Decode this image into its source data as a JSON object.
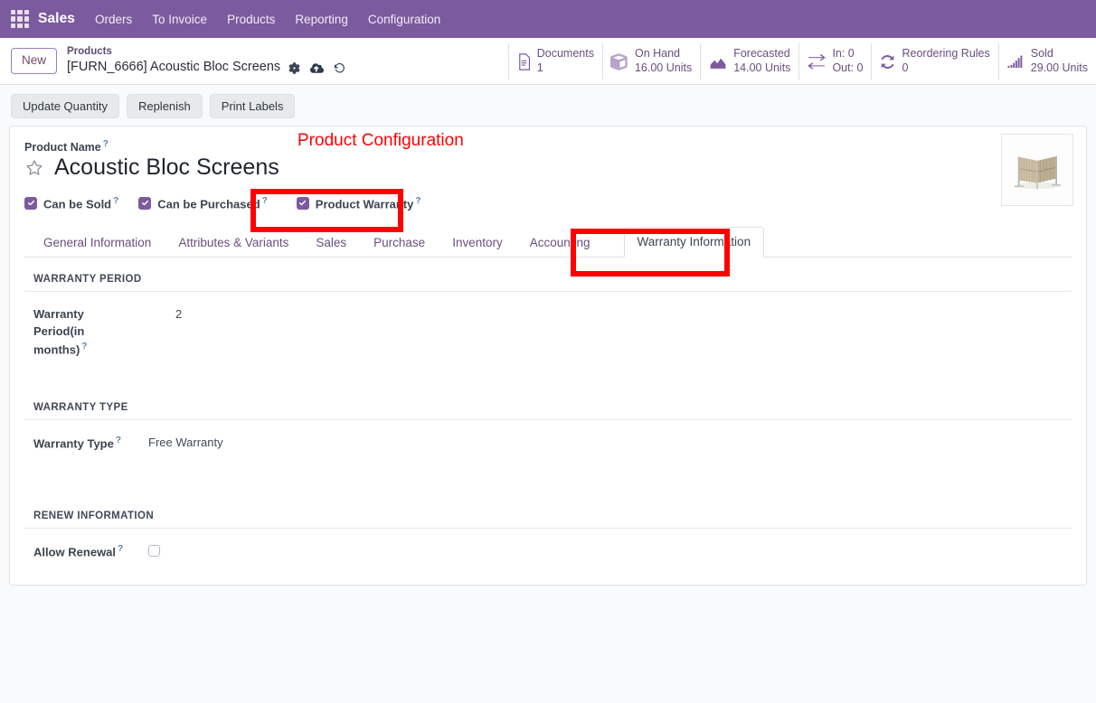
{
  "navbar": {
    "apps_icon": "apps-grid-icon",
    "brand": "Sales",
    "menu": [
      {
        "label": "Orders"
      },
      {
        "label": "To Invoice"
      },
      {
        "label": "Products"
      },
      {
        "label": "Reporting"
      },
      {
        "label": "Configuration"
      }
    ]
  },
  "control_panel": {
    "new_button": "New",
    "breadcrumb_parent": "Products",
    "breadcrumb_current": "[FURN_6666] Acoustic Bloc Screens",
    "icons": [
      {
        "name": "gear-icon",
        "glyph": "⚙"
      },
      {
        "name": "cloud-upload-icon",
        "glyph": "☁"
      },
      {
        "name": "discard-undo-icon",
        "glyph": "↺"
      }
    ],
    "stat_buttons": [
      {
        "name": "documents",
        "icon": "document-icon",
        "line1": "Documents",
        "line2": "1"
      },
      {
        "name": "on-hand",
        "icon": "boxes-icon",
        "line1": "On Hand",
        "line2": "16.00 Units"
      },
      {
        "name": "forecasted",
        "icon": "area-chart-icon",
        "line1": "Forecasted",
        "line2": "14.00 Units"
      },
      {
        "name": "in-out",
        "icon": "exchange-arrows-icon",
        "line1": "In: 0",
        "line2": "Out: 0"
      },
      {
        "name": "reordering-rules",
        "icon": "refresh-cycle-icon",
        "line1": "Reordering Rules",
        "line2": "0"
      },
      {
        "name": "sold",
        "icon": "bar-chart-icon",
        "line1": "Sold",
        "line2": "29.00 Units"
      }
    ]
  },
  "action_buttons": [
    {
      "label": "Update Quantity"
    },
    {
      "label": "Replenish"
    },
    {
      "label": "Print Labels"
    }
  ],
  "form": {
    "product_name_label": "Product Name",
    "product_name": "Acoustic Bloc Screens",
    "favorite_icon": "star-outline-icon",
    "checkboxes": [
      {
        "name": "can-be-sold",
        "label": "Can be Sold",
        "checked": true
      },
      {
        "name": "can-be-purchased",
        "label": "Can be Purchased",
        "checked": true
      },
      {
        "name": "product-warranty",
        "label": "Product Warranty",
        "checked": true
      }
    ],
    "product_image_alt": "acoustic-screen-thumbnail"
  },
  "annotations": {
    "title_text": "Product Configuration",
    "title_color": "#ff0000",
    "box_color": "#ff0000",
    "boxes": [
      {
        "name": "product-warranty-highlight"
      },
      {
        "name": "warranty-information-tab-highlight"
      }
    ]
  },
  "tabs": [
    {
      "label": "General Information",
      "active": false
    },
    {
      "label": "Attributes & Variants",
      "active": false
    },
    {
      "label": "Sales",
      "active": false
    },
    {
      "label": "Purchase",
      "active": false
    },
    {
      "label": "Inventory",
      "active": false
    },
    {
      "label": "Accounting",
      "active": false
    },
    {
      "label": "Warranty Information",
      "active": true
    }
  ],
  "warranty_tab": {
    "sections": [
      {
        "name": "warranty-period",
        "heading": "WARRANTY PERIOD",
        "field_label": "Warranty Period(in months)",
        "field_value": "2",
        "field_type": "number"
      },
      {
        "name": "warranty-type",
        "heading": "WARRANTY TYPE",
        "field_label": "Warranty Type",
        "field_value": "Free Warranty",
        "field_type": "selection"
      },
      {
        "name": "renew-information",
        "heading": "RENEW INFORMATION",
        "field_label": "Allow Renewal",
        "field_value": "",
        "field_type": "checkbox",
        "checked": false
      }
    ]
  },
  "theme": {
    "navbar_bg": "#7c5a9e",
    "accent": "#714B67",
    "page_bg": "#f9fafb",
    "annotation_red": "#ff0000"
  }
}
